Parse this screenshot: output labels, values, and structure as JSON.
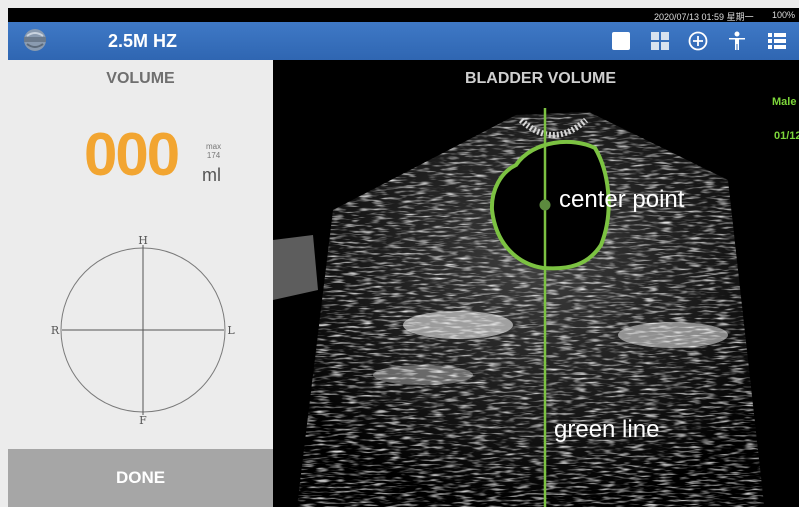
{
  "status_bar": {
    "datetime": "2020/07/13 01:59 星期一",
    "battery": "100%"
  },
  "top_bar": {
    "logo_icon": "probe-logo-icon",
    "frequency": "2.5M HZ",
    "icons": [
      "single-view-icon",
      "quad-view-icon",
      "add-icon",
      "body-mark-icon",
      "menu-list-icon"
    ],
    "background": "#3470bd"
  },
  "volume_panel": {
    "title": "VOLUME",
    "value": "000",
    "max_label": "max",
    "max_value": "174",
    "unit": "ml",
    "orientation": {
      "top": "H",
      "bottom": "F",
      "left": "R",
      "right": "L"
    },
    "done_label": "DONE",
    "value_color": "#f2a531"
  },
  "image_panel": {
    "title": "BLADDER VOLUME",
    "patient_sex": "Male",
    "patient_date": "01/12",
    "annotations": {
      "center_point": "center point",
      "green_line": "green line"
    },
    "outline_color": "#7cc242"
  }
}
